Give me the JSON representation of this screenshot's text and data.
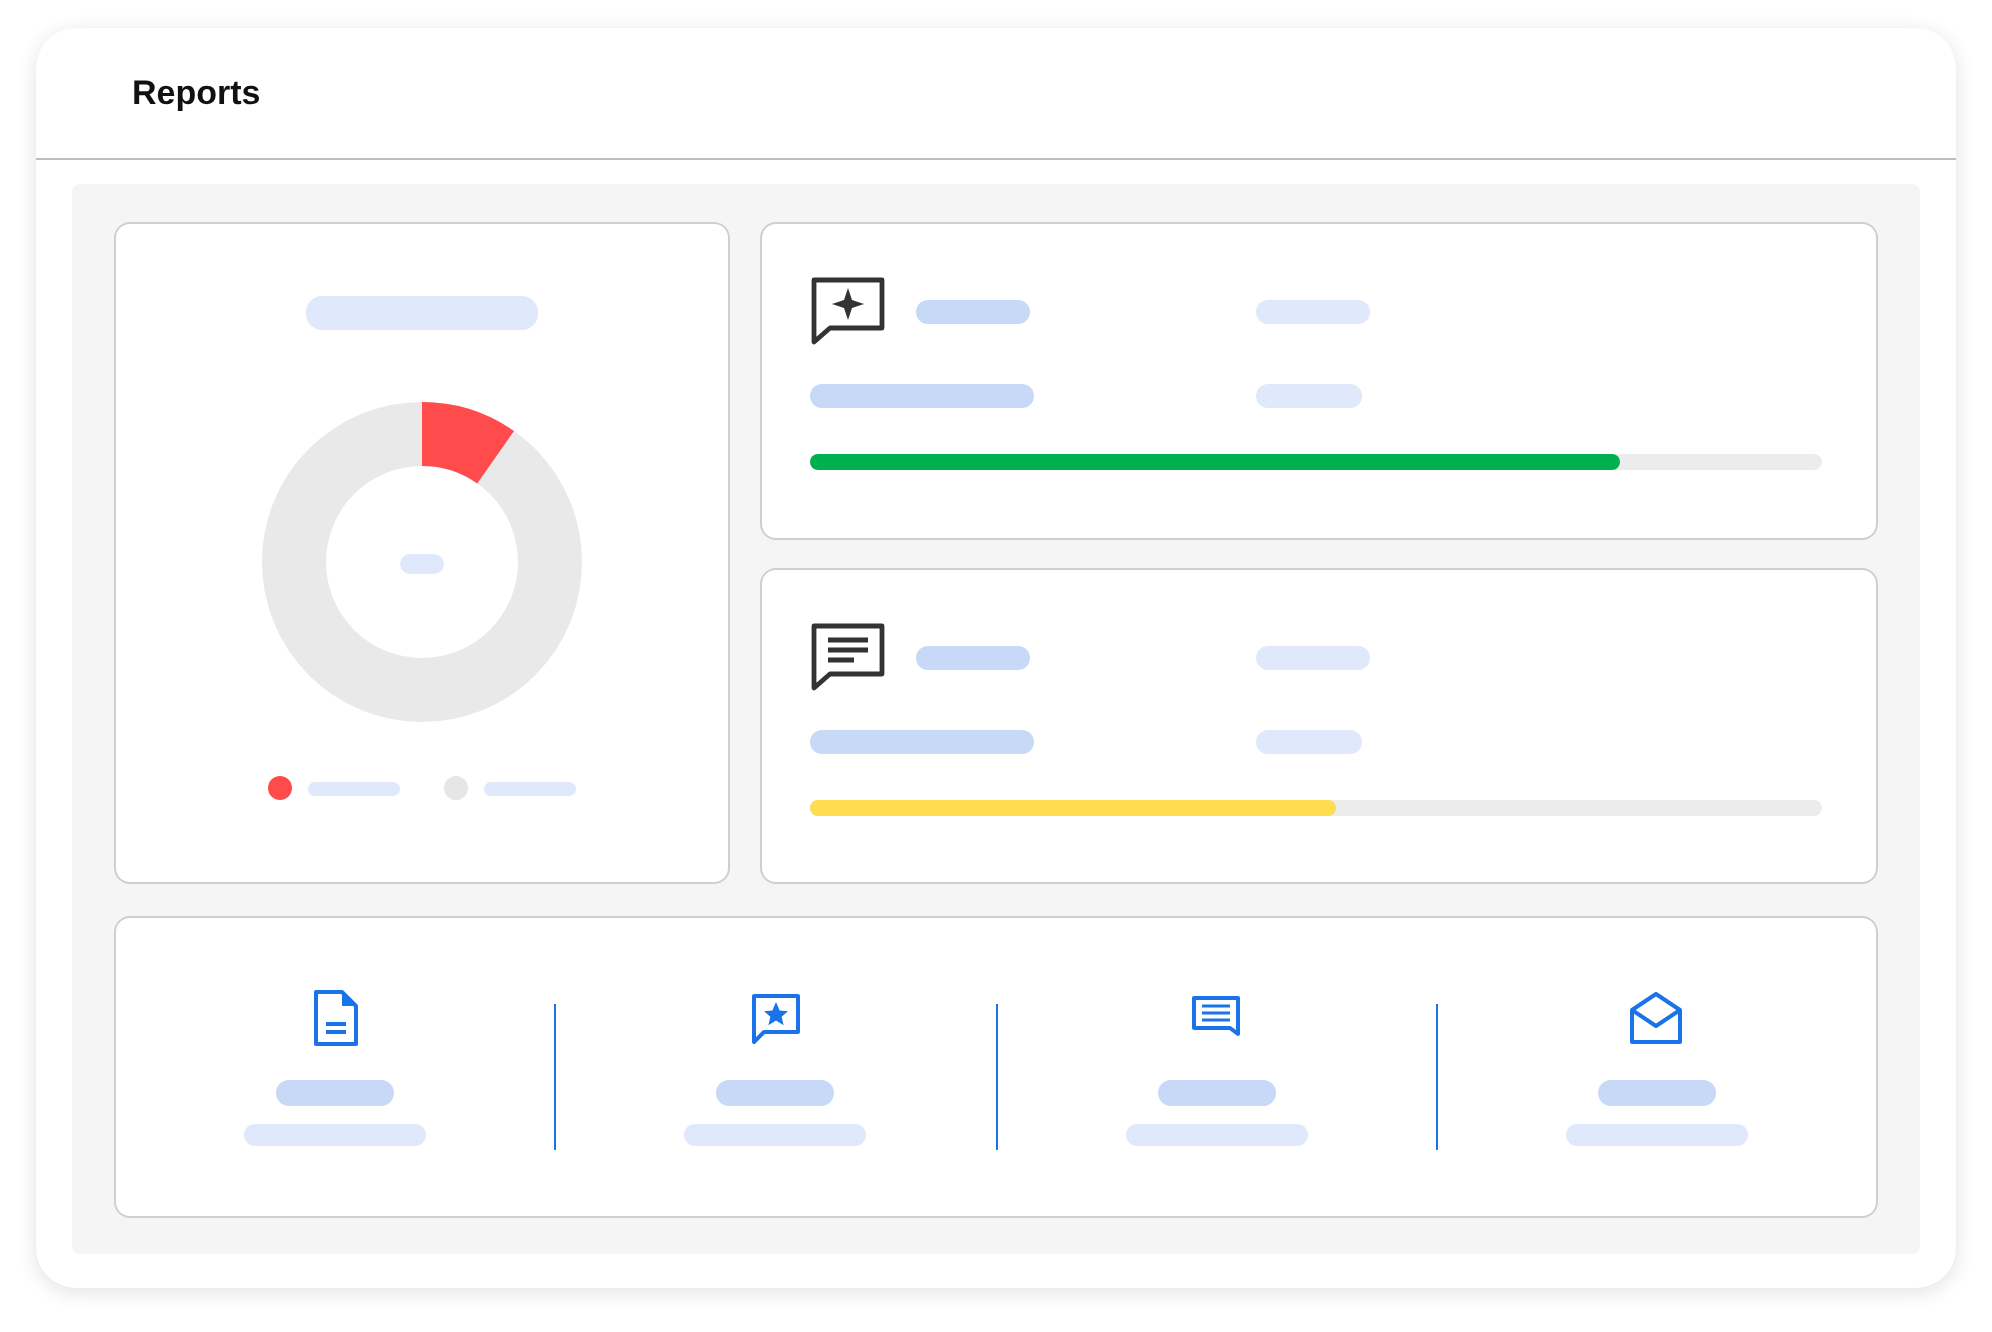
{
  "window": {
    "title": "Reports"
  },
  "legend": [
    {
      "color": "#ff4b4b"
    },
    {
      "color": "#e6e6e6"
    }
  ],
  "metrics": [
    {
      "kind": "sparkle-chat",
      "level": 0.8,
      "color": "#00b050"
    },
    {
      "kind": "text-chat",
      "level": 0.52,
      "color": "#ffdc50"
    }
  ],
  "stats": [
    {
      "kind": "document"
    },
    {
      "kind": "star-chat"
    },
    {
      "kind": "text-chat"
    },
    {
      "kind": "mail"
    }
  ]
}
